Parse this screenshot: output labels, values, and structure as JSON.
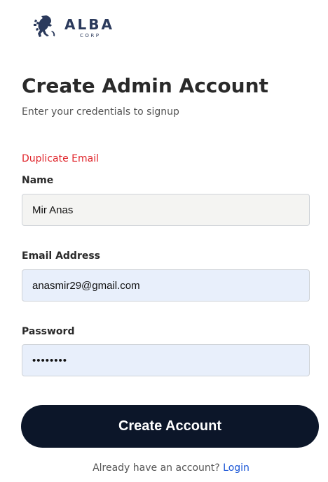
{
  "brand": {
    "name": "ALBA",
    "sub": "CORP",
    "logo_icon": "lion-rampant-icon"
  },
  "header": {
    "title": "Create Admin Account",
    "subtitle": "Enter your credentials to signup"
  },
  "form": {
    "error": "Duplicate Email",
    "name": {
      "label": "Name",
      "value": "Mir Anas"
    },
    "email": {
      "label": "Email Address",
      "value": "anasmir29@gmail.com"
    },
    "password": {
      "label": "Password",
      "value": "********"
    },
    "submit_label": "Create Account"
  },
  "footer": {
    "prompt": "Already have an account?",
    "login_label": "Login"
  },
  "colors": {
    "primary_button": "#0c1629",
    "error": "#e0252b",
    "link": "#1a56d6",
    "brand": "#2b3a5c",
    "autofill_background": "#e8effb"
  }
}
